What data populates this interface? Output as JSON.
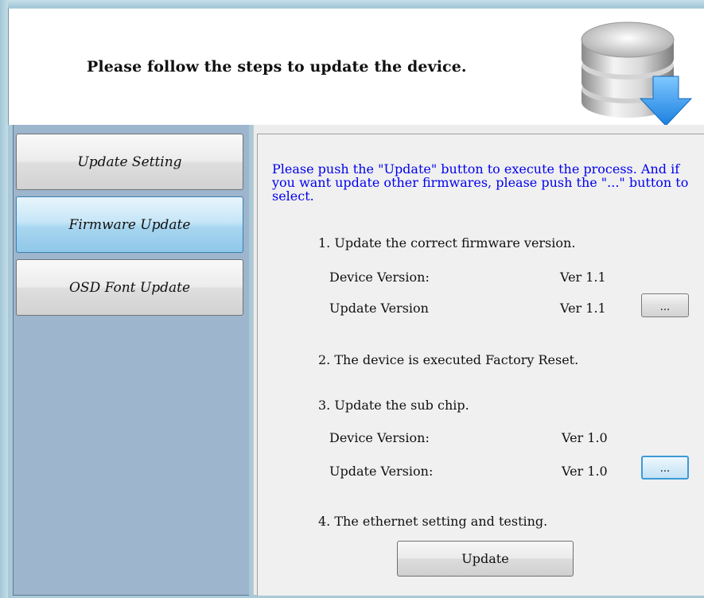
{
  "header": {
    "title": "Please follow the steps to update the device."
  },
  "sidebar": {
    "items": [
      {
        "label": "Update Setting",
        "active": false
      },
      {
        "label": "Firmware Update",
        "active": true
      },
      {
        "label": "OSD Font Update",
        "active": false
      }
    ]
  },
  "content": {
    "instructions": "Please push the \"Update\" button to execute the process. And if you want update other firmwares, please push the \"...\" button to select.",
    "step1": {
      "label": "1. Update the correct firmware version.",
      "device_version_label": "Device Version:",
      "device_version_value": "Ver 1.1",
      "update_version_label": "Update Version",
      "update_version_value": "Ver 1.1",
      "browse_label": "..."
    },
    "step2": {
      "label": "2. The device is executed Factory Reset."
    },
    "step3": {
      "label": "3. Update the sub chip.",
      "device_version_label": "Device Version:",
      "device_version_value": "Ver 1.0",
      "update_version_label": "Update Version:",
      "update_version_value": "Ver 1.0",
      "browse_label": "..."
    },
    "step4": {
      "label": "4. The ethernet setting and testing."
    },
    "update_button_label": "Update"
  },
  "icons": {
    "header_icon": "database-download-icon"
  },
  "colors": {
    "instruction_text": "#0000ee",
    "active_tab": "#a8d6f0",
    "sidebar_bg": "#9db5cd"
  }
}
